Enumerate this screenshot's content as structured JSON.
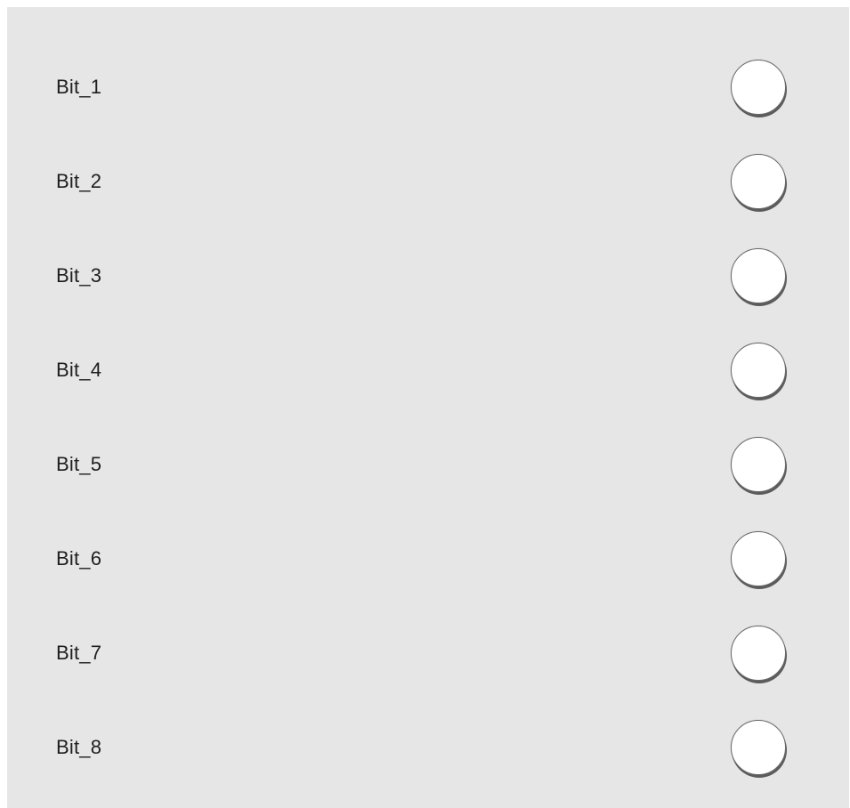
{
  "bits": [
    {
      "label": "Bit_1",
      "state": "off"
    },
    {
      "label": "Bit_2",
      "state": "off"
    },
    {
      "label": "Bit_3",
      "state": "off"
    },
    {
      "label": "Bit_4",
      "state": "off"
    },
    {
      "label": "Bit_5",
      "state": "off"
    },
    {
      "label": "Bit_6",
      "state": "off"
    },
    {
      "label": "Bit_7",
      "state": "off"
    },
    {
      "label": "Bit_8",
      "state": "off"
    }
  ],
  "colors": {
    "panel_background": "#e6e6e6",
    "indicator_off": "#ffffff",
    "label_text": "#1e1e1e"
  }
}
